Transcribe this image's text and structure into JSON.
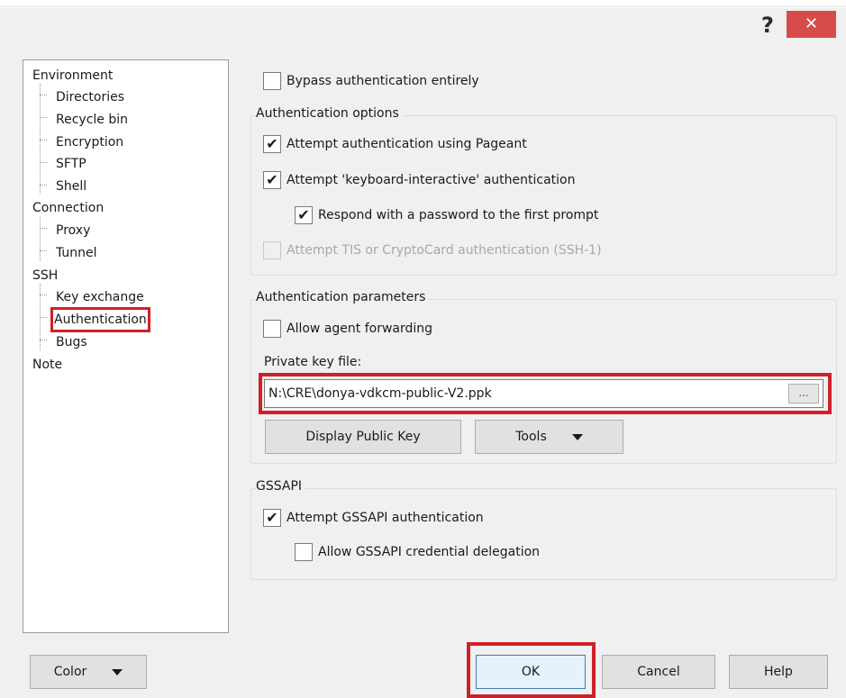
{
  "titlebar": {
    "help_glyph": "?",
    "close_glyph": "✕"
  },
  "tree": {
    "items": [
      {
        "label": "Environment",
        "level": 0
      },
      {
        "label": "Directories",
        "level": 1
      },
      {
        "label": "Recycle bin",
        "level": 1
      },
      {
        "label": "Encryption",
        "level": 1
      },
      {
        "label": "SFTP",
        "level": 1
      },
      {
        "label": "Shell",
        "level": 1
      },
      {
        "label": "Connection",
        "level": 0
      },
      {
        "label": "Proxy",
        "level": 1
      },
      {
        "label": "Tunnel",
        "level": 1
      },
      {
        "label": "SSH",
        "level": 0
      },
      {
        "label": "Key exchange",
        "level": 1
      },
      {
        "label": "Authentication",
        "level": 1,
        "selected": true
      },
      {
        "label": "Bugs",
        "level": 1
      },
      {
        "label": "Note",
        "level": 0
      }
    ]
  },
  "bypass": {
    "label": "Bypass authentication entirely",
    "checked": false
  },
  "auth_options": {
    "title": "Authentication options",
    "pageant": {
      "label": "Attempt authentication using Pageant",
      "checked": true
    },
    "keyboard_interactive": {
      "label": "Attempt 'keyboard-interactive' authentication",
      "checked": true
    },
    "respond_password": {
      "label": "Respond with a password to the first prompt",
      "checked": true
    },
    "tis": {
      "label": "Attempt TIS or CryptoCard authentication (SSH-1)",
      "checked": false,
      "disabled": true
    }
  },
  "auth_params": {
    "title": "Authentication parameters",
    "agent_forwarding": {
      "label": "Allow agent forwarding",
      "checked": false
    },
    "private_key_label": "Private key file:",
    "private_key_value": "N:\\CRE\\donya-vdkcm-public-V2.ppk",
    "browse_label": "...",
    "display_public_key": "Display Public Key",
    "tools": "Tools"
  },
  "gssapi": {
    "title": "GSSAPI",
    "attempt": {
      "label": "Attempt GSSAPI authentication",
      "checked": true
    },
    "delegation": {
      "label": "Allow GSSAPI credential delegation",
      "checked": false
    }
  },
  "footer": {
    "color": "Color",
    "ok": "OK",
    "cancel": "Cancel",
    "help": "Help"
  },
  "check_glyph": "✔",
  "colors": {
    "highlight": "#d0202a",
    "close": "#d74b4b"
  }
}
